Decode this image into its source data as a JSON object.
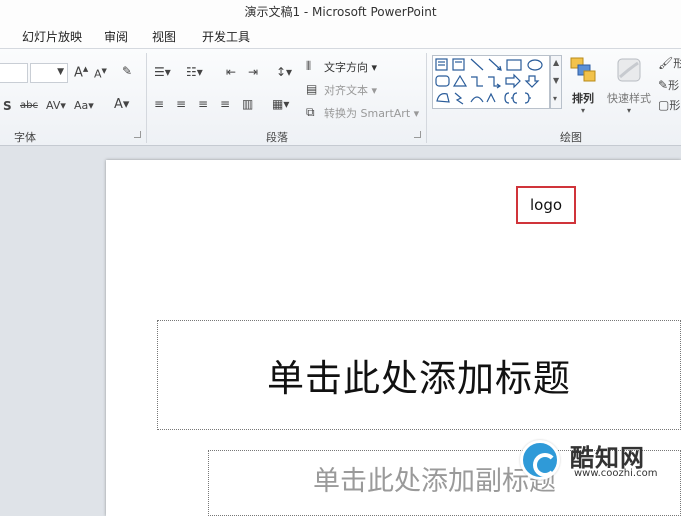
{
  "window": {
    "title": "演示文稿1 - Microsoft PowerPoint"
  },
  "menu": {
    "items": [
      "幻灯片放映",
      "审阅",
      "视图",
      "开发工具"
    ]
  },
  "ribbon": {
    "font_group": {
      "label": "字体",
      "grow_font": "A",
      "shrink_font": "A",
      "strike_sample": "abc",
      "spacing_sample": "AV",
      "case_sample": "Aa",
      "color_sample": "A"
    },
    "paragraph_group": {
      "label": "段落",
      "text_direction": "文字方向",
      "align_text": "对齐文本",
      "convert_smartart": "转换为 SmartArt"
    },
    "drawing_group": {
      "label": "绘图",
      "arrange": "排列",
      "quick_styles": "快速样式",
      "shape_fill_partial": "形",
      "shape_outline_partial": "形",
      "shape_effects_partial": "形"
    }
  },
  "slide": {
    "logo_text": "logo",
    "title_placeholder": "单击此处添加标题",
    "subtitle_placeholder": "单击此处添加副标题"
  },
  "watermark": {
    "name": "酷知网",
    "url": "www.coozhi.com"
  },
  "colors": {
    "logo_border": "#d0343a",
    "watermark_blue": "#2f9ad8"
  }
}
